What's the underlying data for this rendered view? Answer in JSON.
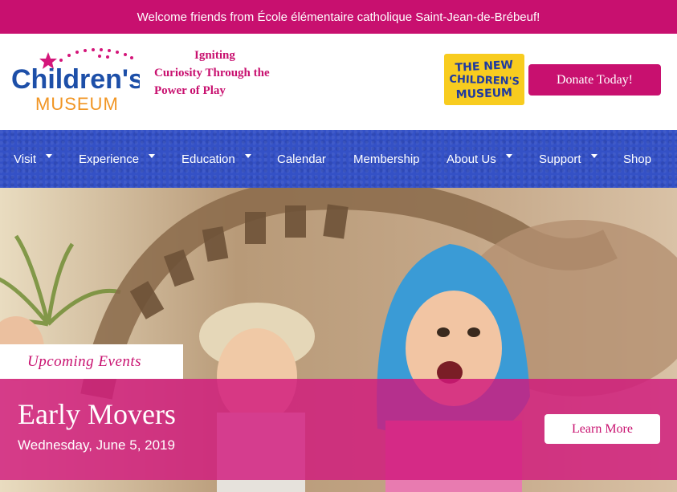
{
  "top_banner": {
    "text": "Welcome friends from École élémentaire catholique Saint-Jean-de-Brébeuf!"
  },
  "header": {
    "logo": {
      "line1": "Children's",
      "line2": "MUSEUM"
    },
    "tagline": {
      "line1": "Igniting",
      "line2": "Curiosity Through the",
      "line3": "Power of Play"
    },
    "new_museum_badge": {
      "line1": "THE NEW",
      "line2": "CHILDREN'S",
      "line3": "MUSEUM"
    },
    "donate_label": "Donate Today!"
  },
  "nav": {
    "items": [
      {
        "label": "Visit",
        "has_dropdown": true
      },
      {
        "label": "Experience",
        "has_dropdown": true
      },
      {
        "label": "Education",
        "has_dropdown": true
      },
      {
        "label": "Calendar",
        "has_dropdown": false
      },
      {
        "label": "Membership",
        "has_dropdown": false
      },
      {
        "label": "About Us",
        "has_dropdown": true
      },
      {
        "label": "Support",
        "has_dropdown": true
      },
      {
        "label": "Shop",
        "has_dropdown": false
      }
    ]
  },
  "hero": {
    "section_tab": "Upcoming Events",
    "event_title": "Early Movers",
    "event_date": "Wednesday, June 5, 2019",
    "learn_more_label": "Learn More"
  },
  "colors": {
    "brand_magenta": "#c8106f",
    "nav_blue": "#3451c6",
    "badge_yellow": "#f8cc1f",
    "logo_blue": "#1d4fa8",
    "logo_orange": "#f19523"
  }
}
